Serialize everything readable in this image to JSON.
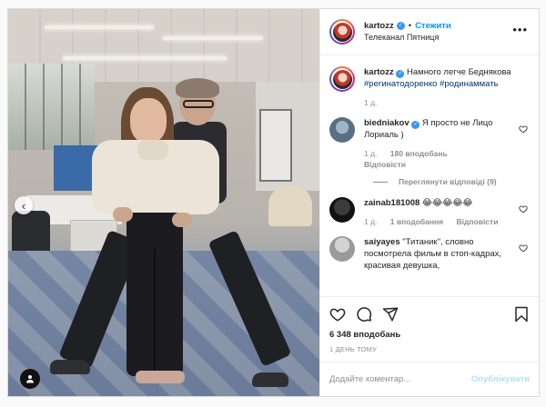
{
  "post": {
    "author": "kartozz",
    "follow_label": "Стежити",
    "location": "Телеканал Пятниця",
    "more_label": "•••"
  },
  "caption": {
    "username": "kartozz",
    "text": "Намного легче Беднякова",
    "hashtags": "#регинатодоренко #родинаммать",
    "time": "1 д."
  },
  "comments": [
    {
      "username": "biedniakov",
      "verified": true,
      "text": "Я просто не Лицо Лориаль )",
      "time": "1 д.",
      "likes": "180 вподобань",
      "reply": "Відповісти"
    },
    {
      "username": "zainab181008",
      "verified": false,
      "text": "😂😂😂😂😂",
      "time": "1 д.",
      "likes": "1 вподобання",
      "reply": "Відповісти"
    },
    {
      "username": "saiyayes",
      "verified": false,
      "text": "\"Титаник\", словно посмотрела фильм в стоп-кадрах, красивая девушка,",
      "time": "",
      "likes": "",
      "reply": ""
    }
  ],
  "view_replies": "Переглянути відповіді (9)",
  "likes_total": "6 348 вподобань",
  "posted": "1 ДЕНЬ ТОМУ",
  "comment_input": {
    "placeholder": "Додайте коментар...",
    "value": ""
  },
  "publish_label": "Опублікувати",
  "icons": {
    "like": "heart-icon",
    "comment": "comment-icon",
    "share": "share-icon",
    "save": "bookmark-icon",
    "prev": "chevron-left-icon",
    "tags": "user-tag-icon",
    "options": "more-icon",
    "verified": "verified-badge-icon"
  },
  "colors": {
    "link": "#0095f6",
    "hashtag": "#00376b",
    "muted": "#8e8e8e",
    "verified": "#3897f0",
    "publish_disabled": "#b2dffc"
  }
}
